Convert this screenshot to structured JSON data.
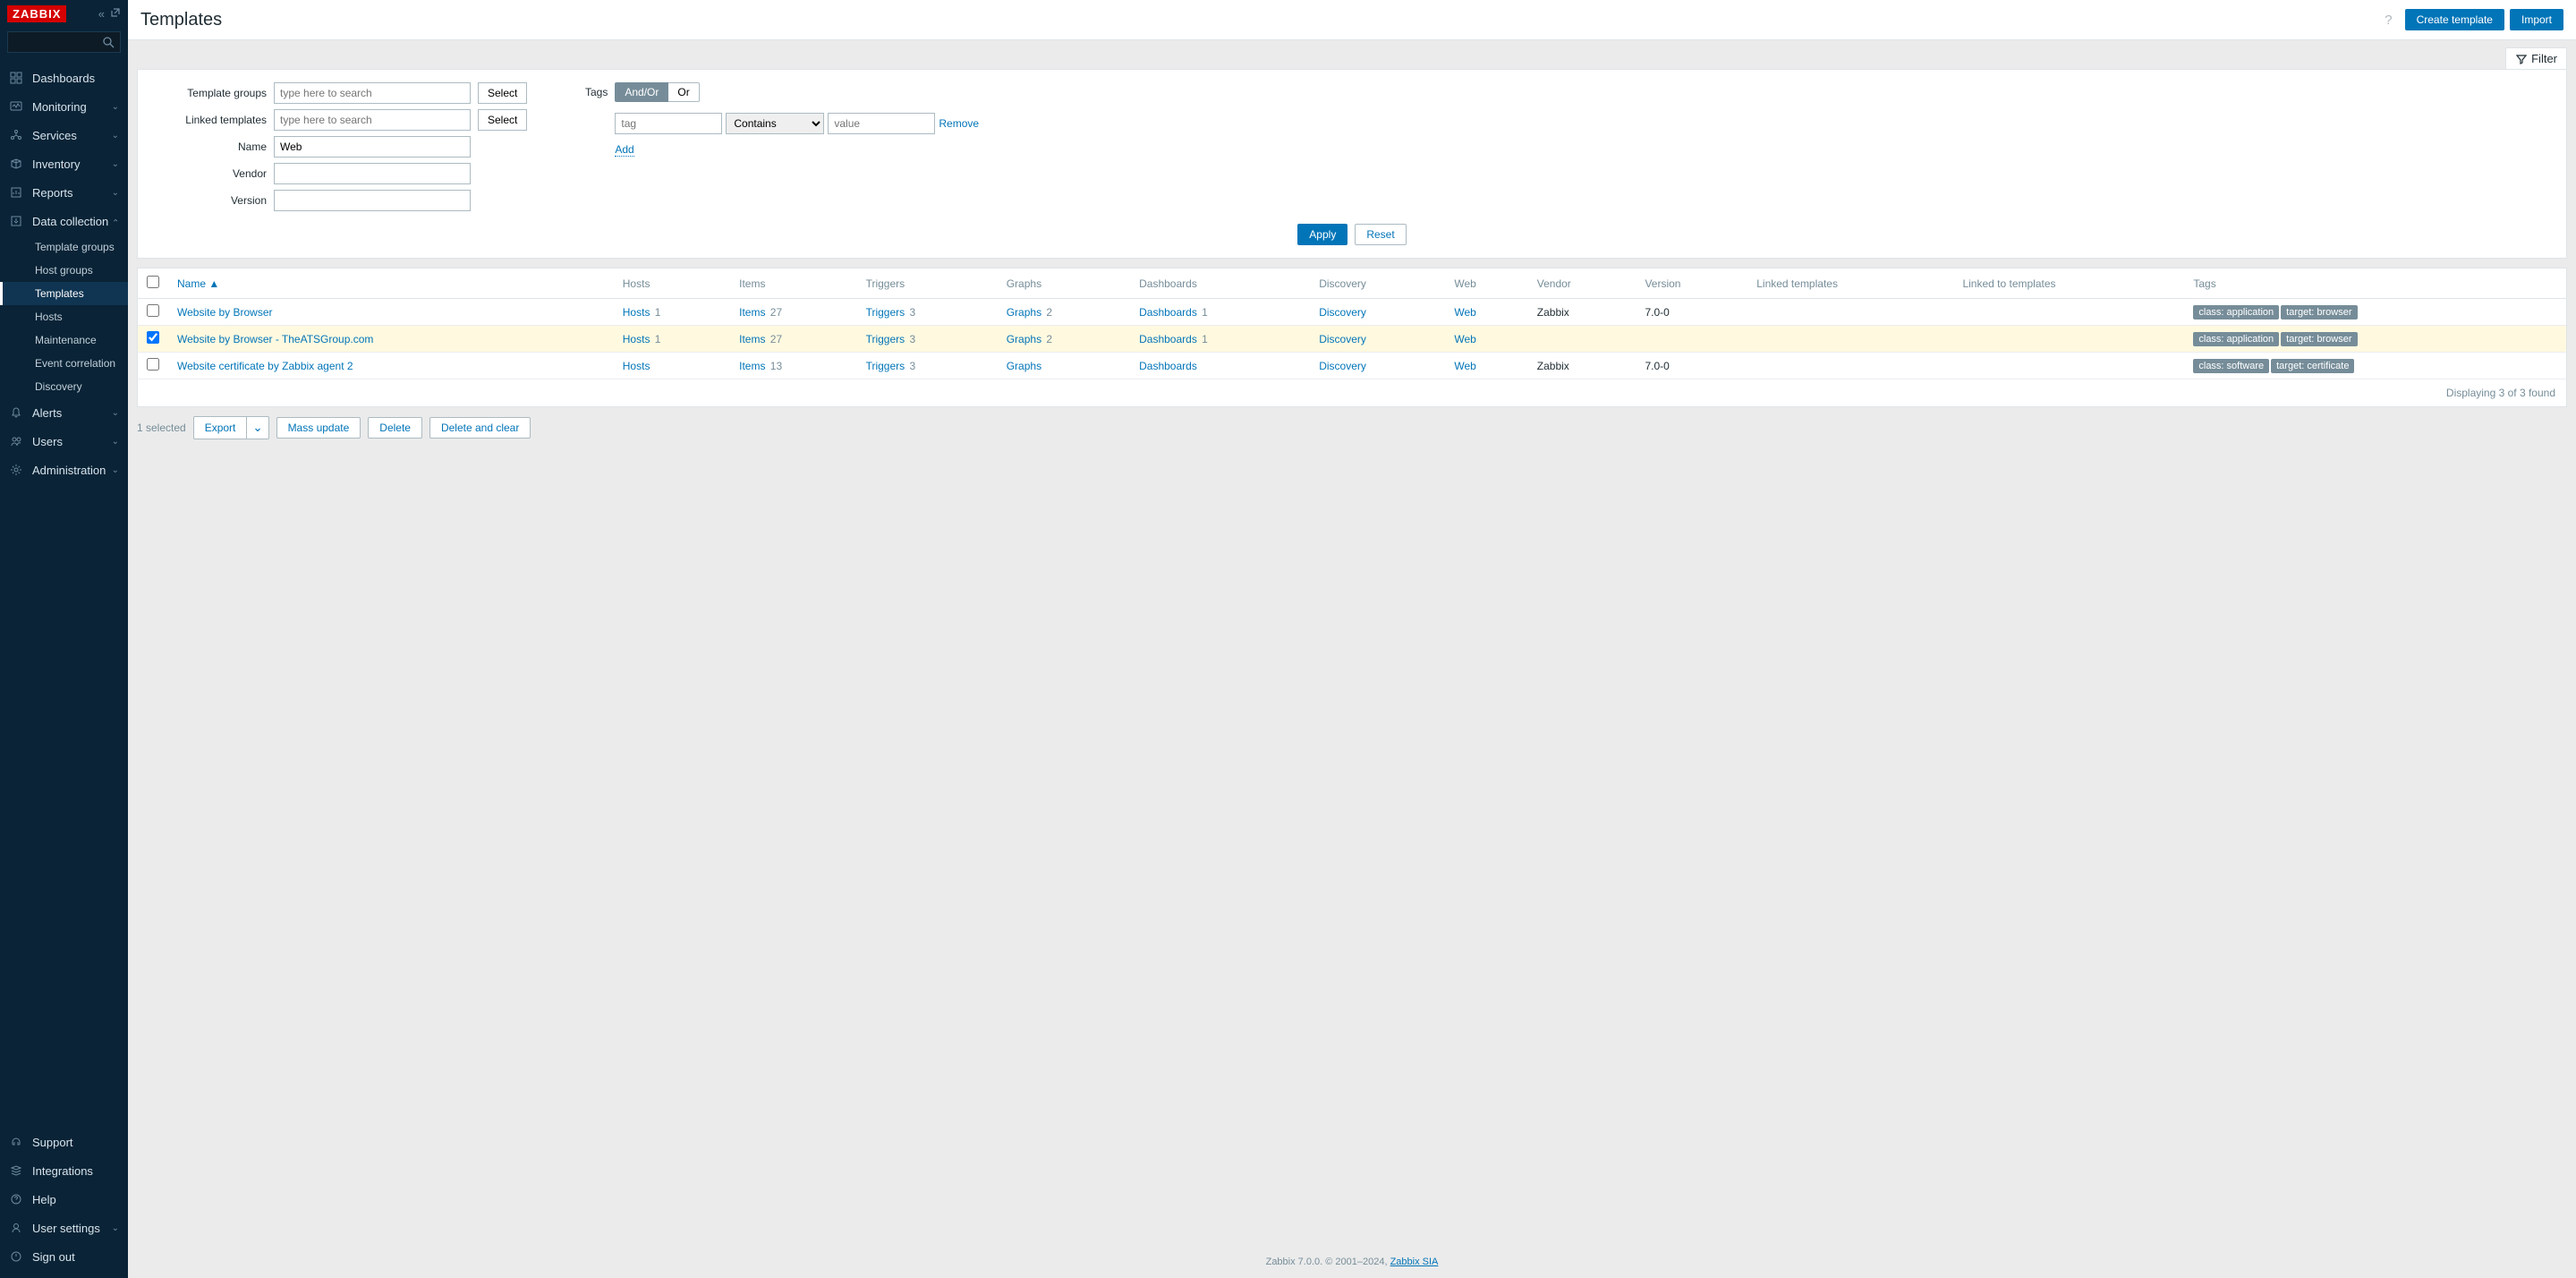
{
  "logo": "ZABBIX",
  "search": {
    "placeholder": ""
  },
  "nav": {
    "dashboards": "Dashboards",
    "monitoring": "Monitoring",
    "services": "Services",
    "inventory": "Inventory",
    "reports": "Reports",
    "data_collection": "Data collection",
    "alerts": "Alerts",
    "users": "Users",
    "administration": "Administration"
  },
  "subnav": {
    "template_groups": "Template groups",
    "host_groups": "Host groups",
    "templates": "Templates",
    "hosts": "Hosts",
    "maintenance": "Maintenance",
    "event_correlation": "Event correlation",
    "discovery": "Discovery"
  },
  "nav_bottom": {
    "support": "Support",
    "integrations": "Integrations",
    "help": "Help",
    "user_settings": "User settings",
    "sign_out": "Sign out"
  },
  "page": {
    "title": "Templates",
    "create_template": "Create template",
    "import": "Import"
  },
  "filter": {
    "tab_label": "Filter",
    "template_groups": "Template groups",
    "linked_templates": "Linked templates",
    "name": "Name",
    "vendor": "Vendor",
    "version": "Version",
    "name_value": "Web",
    "select": "Select",
    "placeholder": "type here to search",
    "tags_label": "Tags",
    "and_or": "And/Or",
    "or": "Or",
    "tag_placeholder": "tag",
    "operator": "Contains",
    "value_placeholder": "value",
    "remove": "Remove",
    "add": "Add",
    "apply": "Apply",
    "reset": "Reset"
  },
  "table": {
    "headers": {
      "name": "Name",
      "hosts": "Hosts",
      "items": "Items",
      "triggers": "Triggers",
      "graphs": "Graphs",
      "dashboards": "Dashboards",
      "discovery": "Discovery",
      "web": "Web",
      "vendor": "Vendor",
      "version": "Version",
      "linked_templates": "Linked templates",
      "linked_to_templates": "Linked to templates",
      "tags": "Tags"
    },
    "rows": [
      {
        "selected": false,
        "name": "Website by Browser",
        "hosts": "Hosts",
        "hosts_n": "1",
        "items": "Items",
        "items_n": "27",
        "triggers": "Triggers",
        "triggers_n": "3",
        "graphs": "Graphs",
        "graphs_n": "2",
        "dashboards": "Dashboards",
        "dashboards_n": "1",
        "discovery": "Discovery",
        "web": "Web",
        "vendor": "Zabbix",
        "version": "7.0-0",
        "tags": [
          "class: application",
          "target: browser"
        ]
      },
      {
        "selected": true,
        "name": "Website by Browser - TheATSGroup.com",
        "hosts": "Hosts",
        "hosts_n": "1",
        "items": "Items",
        "items_n": "27",
        "triggers": "Triggers",
        "triggers_n": "3",
        "graphs": "Graphs",
        "graphs_n": "2",
        "dashboards": "Dashboards",
        "dashboards_n": "1",
        "discovery": "Discovery",
        "web": "Web",
        "vendor": "",
        "version": "",
        "tags": [
          "class: application",
          "target: browser"
        ]
      },
      {
        "selected": false,
        "name": "Website certificate by Zabbix agent 2",
        "hosts": "Hosts",
        "hosts_n": "",
        "items": "Items",
        "items_n": "13",
        "triggers": "Triggers",
        "triggers_n": "3",
        "graphs": "Graphs",
        "graphs_n": "",
        "dashboards": "Dashboards",
        "dashboards_n": "",
        "discovery": "Discovery",
        "web": "Web",
        "vendor": "Zabbix",
        "version": "7.0-0",
        "tags": [
          "class: software",
          "target: certificate"
        ]
      }
    ],
    "footer": "Displaying 3 of 3 found"
  },
  "actions": {
    "selected": "1 selected",
    "export": "Export",
    "mass_update": "Mass update",
    "delete": "Delete",
    "delete_clear": "Delete and clear"
  },
  "footer": {
    "text1": "Zabbix 7.0.0. © 2001–2024, ",
    "link": "Zabbix SIA"
  }
}
